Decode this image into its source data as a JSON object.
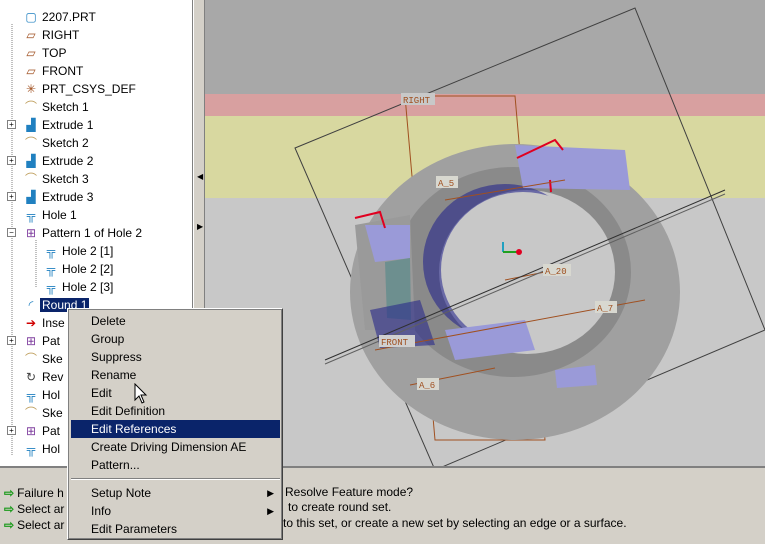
{
  "tree": {
    "items": [
      {
        "label": "2207.PRT",
        "icon": "part-icon"
      },
      {
        "label": "RIGHT",
        "icon": "datum-plane-icon"
      },
      {
        "label": "TOP",
        "icon": "datum-plane-icon"
      },
      {
        "label": "FRONT",
        "icon": "datum-plane-icon"
      },
      {
        "label": "PRT_CSYS_DEF",
        "icon": "csys-icon"
      },
      {
        "label": "Sketch 1",
        "icon": "sketch-icon"
      },
      {
        "label": "Extrude 1",
        "icon": "extrude-icon"
      },
      {
        "label": "Sketch 2",
        "icon": "sketch-icon"
      },
      {
        "label": "Extrude 2",
        "icon": "extrude-icon"
      },
      {
        "label": "Sketch 3",
        "icon": "sketch-icon"
      },
      {
        "label": "Extrude 3",
        "icon": "extrude-icon"
      },
      {
        "label": "Hole 1",
        "icon": "hole-icon"
      },
      {
        "label": "Pattern 1 of Hole 2",
        "icon": "pattern-icon"
      },
      {
        "label": "Hole 2 [1]",
        "icon": "hole-icon"
      },
      {
        "label": "Hole 2 [2]",
        "icon": "hole-icon"
      },
      {
        "label": "Hole 2 [3]",
        "icon": "hole-icon"
      },
      {
        "label": "Round 1",
        "icon": "round-icon"
      },
      {
        "label": "Inse",
        "icon": "insert-arrow-icon"
      },
      {
        "label": "Pat",
        "icon": "pattern-icon"
      },
      {
        "label": "Ske",
        "icon": "sketch-icon"
      },
      {
        "label": "Rev",
        "icon": "revolve-icon"
      },
      {
        "label": "Hol",
        "icon": "hole-icon"
      },
      {
        "label": "Ske",
        "icon": "sketch-icon"
      },
      {
        "label": "Pat",
        "icon": "pattern-icon"
      },
      {
        "label": "Hol",
        "icon": "hole-icon"
      }
    ]
  },
  "viewport": {
    "datum_labels": {
      "right": "RIGHT",
      "front": "FRONT",
      "a5": "A_5",
      "a7": "A_7",
      "a6": "A_6",
      "a20": "A_20"
    }
  },
  "context_menu": {
    "items": [
      {
        "label": "Delete"
      },
      {
        "label": "Group"
      },
      {
        "label": "Suppress"
      },
      {
        "label": "Rename"
      },
      {
        "label": "Edit"
      },
      {
        "label": "Edit Definition"
      },
      {
        "label": "Edit References",
        "highlighted": true
      },
      {
        "label": "Create Driving Dimension AE"
      },
      {
        "label": "Pattern..."
      },
      {
        "label": "Setup Note",
        "submenu": true
      },
      {
        "label": "Info",
        "submenu": true
      },
      {
        "label": "Edit Parameters"
      }
    ]
  },
  "messages": {
    "line1_head": "Failure h",
    "line1_tail": "Resolve Feature mode?",
    "line2_head": "Select ar",
    "line2_tail": "to create round set.",
    "line3_head": "Select ar",
    "line3_tail": "to this set, or create a new set by selecting an edge or a surface."
  },
  "colors": {
    "selection": "#0a246a",
    "message_arrow": "#1a9a1a",
    "model_gray": "#9a9a9a",
    "surface_highlight": "#9090d0",
    "datum_line": "#a05020"
  }
}
